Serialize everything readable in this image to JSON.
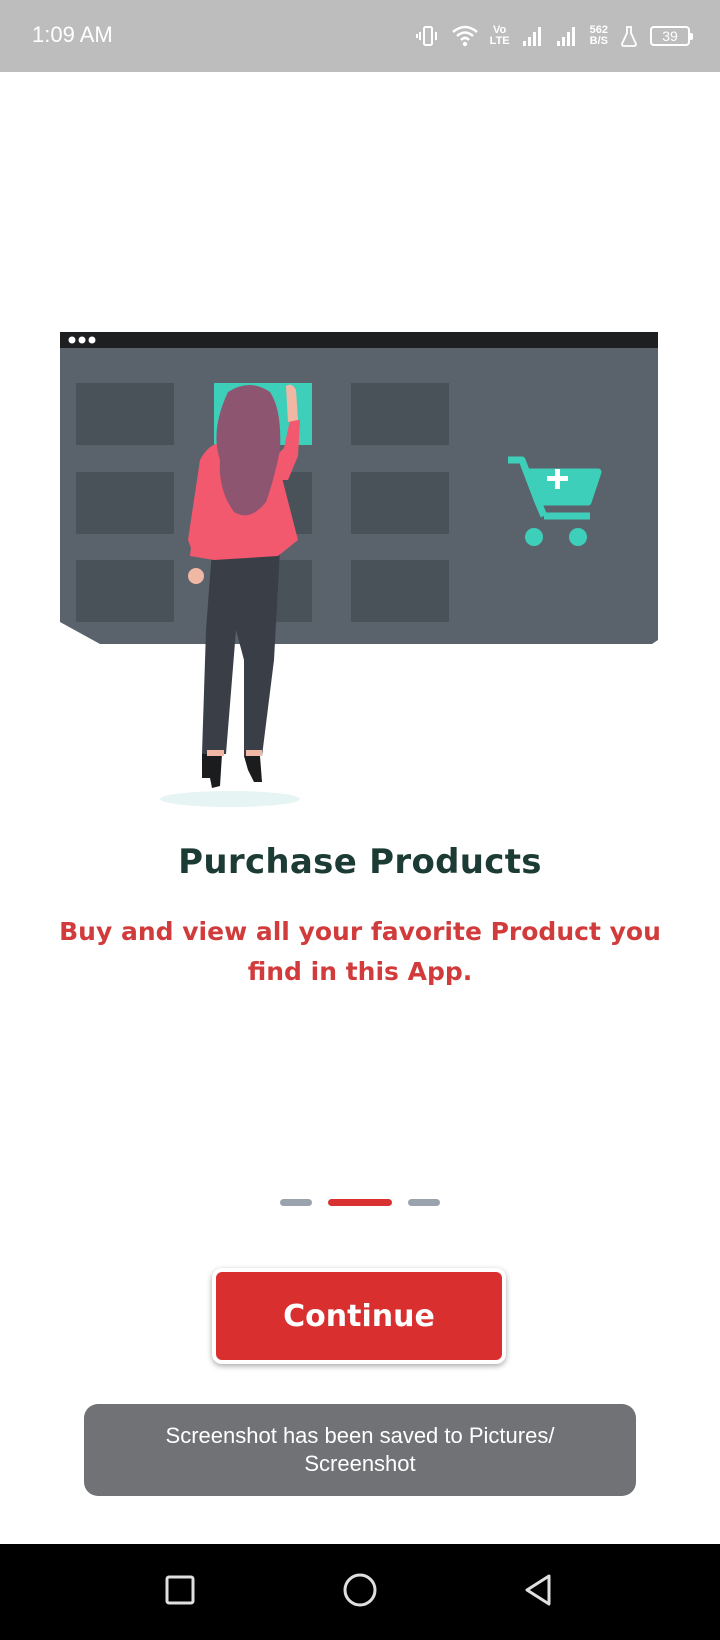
{
  "status_bar": {
    "time": "1:09 AM",
    "net_speed_value": "562",
    "net_speed_unit": "B/S",
    "volte_top": "Vo",
    "volte_bottom": "LTE",
    "battery": "39"
  },
  "illustration": {
    "description_icon": "shopping-illustration",
    "accent_color": "#3ecfba"
  },
  "onboarding": {
    "title": "Purchase Products",
    "subtitle": "Buy and view all your favorite Product you find in this App.",
    "page_count": 3,
    "current_page": 2
  },
  "continue_button": {
    "label": "Continue"
  },
  "toast": {
    "line1": "Screenshot has been saved to  Pictures/",
    "line2": "Screenshot"
  },
  "nav_bar": {
    "recent_icon": "square-icon",
    "home_icon": "circle-icon",
    "back_icon": "triangle-back-icon"
  },
  "colors": {
    "primary": "#d92f2f",
    "title": "#1c3b34",
    "subtitle": "#d13b3b",
    "indicator_inactive": "#9aa3ad"
  }
}
